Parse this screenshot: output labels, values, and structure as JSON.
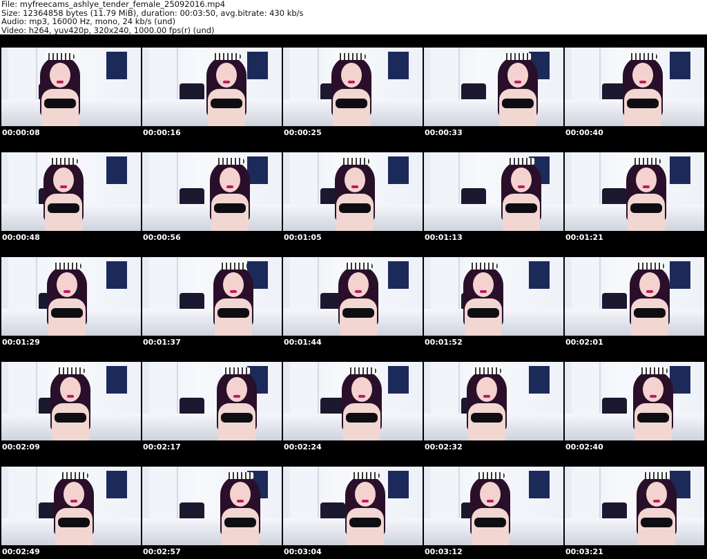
{
  "header": {
    "file_line": "File: myfreecams_ashlye_tender_female_25092016.mp4",
    "size_line": "Size: 12364858 bytes (11.79 MiB), duration: 00:03:50, avg.bitrate: 430 kb/s",
    "audio_line": "Audio: mp3, 16000 Hz, mono, 24 kb/s (und)",
    "video_line": "Video: h264, yuv420p, 320x240, 1000.00 fps(r) (und)"
  },
  "thumbnails": [
    {
      "timestamp": "00:00:08"
    },
    {
      "timestamp": "00:00:16"
    },
    {
      "timestamp": "00:00:25"
    },
    {
      "timestamp": "00:00:33"
    },
    {
      "timestamp": "00:00:40"
    },
    {
      "timestamp": "00:00:48"
    },
    {
      "timestamp": "00:00:56"
    },
    {
      "timestamp": "00:01:05"
    },
    {
      "timestamp": "00:01:13"
    },
    {
      "timestamp": "00:01:21"
    },
    {
      "timestamp": "00:01:29"
    },
    {
      "timestamp": "00:01:37"
    },
    {
      "timestamp": "00:01:44"
    },
    {
      "timestamp": "00:01:52"
    },
    {
      "timestamp": "00:02:01"
    },
    {
      "timestamp": "00:02:09"
    },
    {
      "timestamp": "00:02:17"
    },
    {
      "timestamp": "00:02:24"
    },
    {
      "timestamp": "00:02:32"
    },
    {
      "timestamp": "00:02:40"
    },
    {
      "timestamp": "00:02:49"
    },
    {
      "timestamp": "00:02:57"
    },
    {
      "timestamp": "00:03:04"
    },
    {
      "timestamp": "00:03:12"
    },
    {
      "timestamp": "00:03:21"
    }
  ]
}
